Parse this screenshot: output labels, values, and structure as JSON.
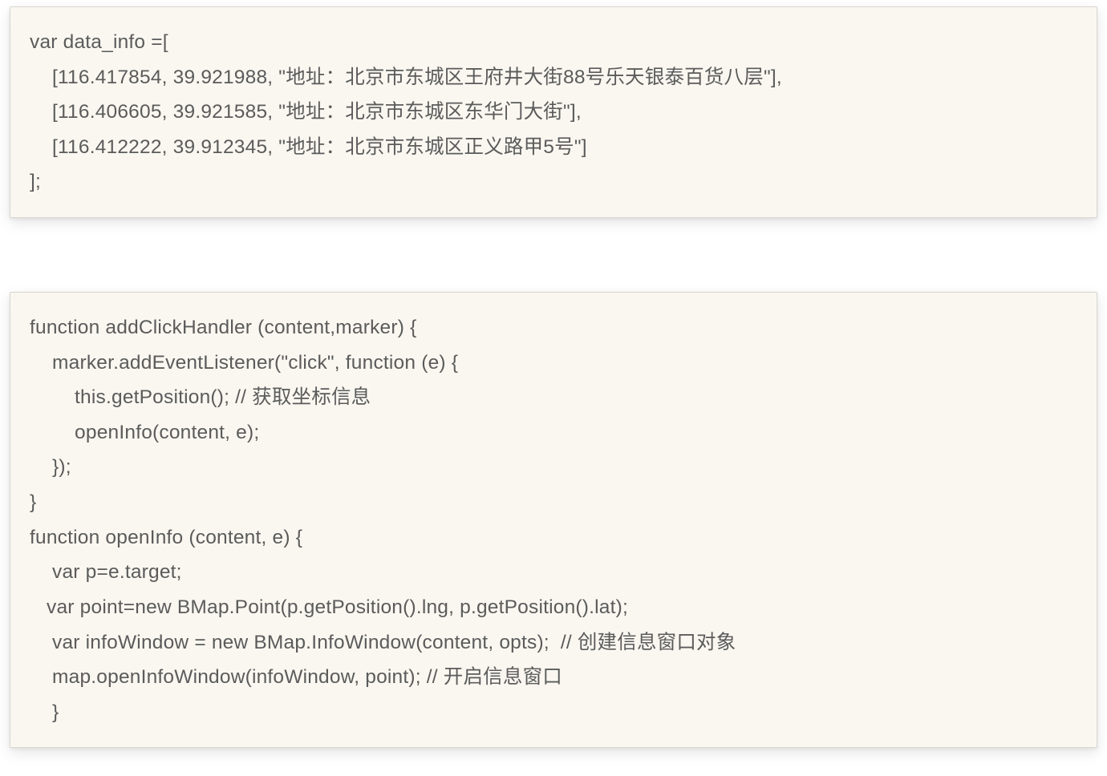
{
  "blocks": [
    {
      "code": "var data_info =[\n    [116.417854, 39.921988, \"地址：北京市东城区王府井大街88号乐天银泰百货八层\"],\n    [116.406605, 39.921585, \"地址：北京市东城区东华门大街\"],\n    [116.412222, 39.912345, \"地址：北京市东城区正义路甲5号\"]\n];"
    },
    {
      "code": "function addClickHandler (content,marker) {\n    marker.addEventListener(\"click\", function (e) {\n        this.getPosition(); // 获取坐标信息\n        openInfo(content, e);\n    });\n}\nfunction openInfo (content, e) {\n    var p=e.target;\n   var point=new BMap.Point(p.getPosition().lng, p.getPosition().lat);\n    var infoWindow = new BMap.InfoWindow(content, opts);  // 创建信息窗口对象\n    map.openInfoWindow(infoWindow, point); // 开启信息窗口\n    }"
    }
  ]
}
